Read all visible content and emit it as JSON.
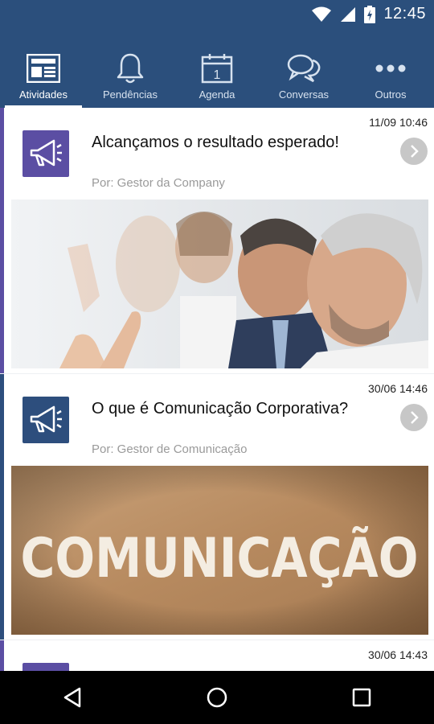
{
  "status_bar": {
    "time": "12:45"
  },
  "tabs": [
    {
      "label": "Atividades",
      "icon": "newspaper-icon",
      "active": true
    },
    {
      "label": "Pendências",
      "icon": "bell-icon"
    },
    {
      "label": "Agenda",
      "icon": "calendar-icon",
      "day": "1"
    },
    {
      "label": "Conversas",
      "icon": "chat-bubbles-icon"
    },
    {
      "label": "Outros",
      "icon": "more-dots-icon"
    }
  ],
  "feed": [
    {
      "date": "11/09 10:46",
      "title": "Alcançamos o resultado esperado!",
      "author": "Por: Gestor da Company",
      "accent": "#5b4ea3",
      "icon": "megaphone-icon",
      "image": "applauding-people-photo"
    },
    {
      "date": "30/06 14:46",
      "title": "O que é Comunicação Corporativa?",
      "author": "Por: Gestor de Comunicação",
      "accent": "#2d4e7d",
      "icon": "megaphone-icon",
      "image": "comunicacao-banner",
      "image_text": "COMUNICAÇÃO"
    },
    {
      "date": "30/06 14:43",
      "accent": "#5b4ea3",
      "icon": "megaphone-icon"
    }
  ],
  "colors": {
    "primary": "#2b4f7c",
    "purple": "#5b4ea3",
    "navy": "#2d4e7d"
  }
}
